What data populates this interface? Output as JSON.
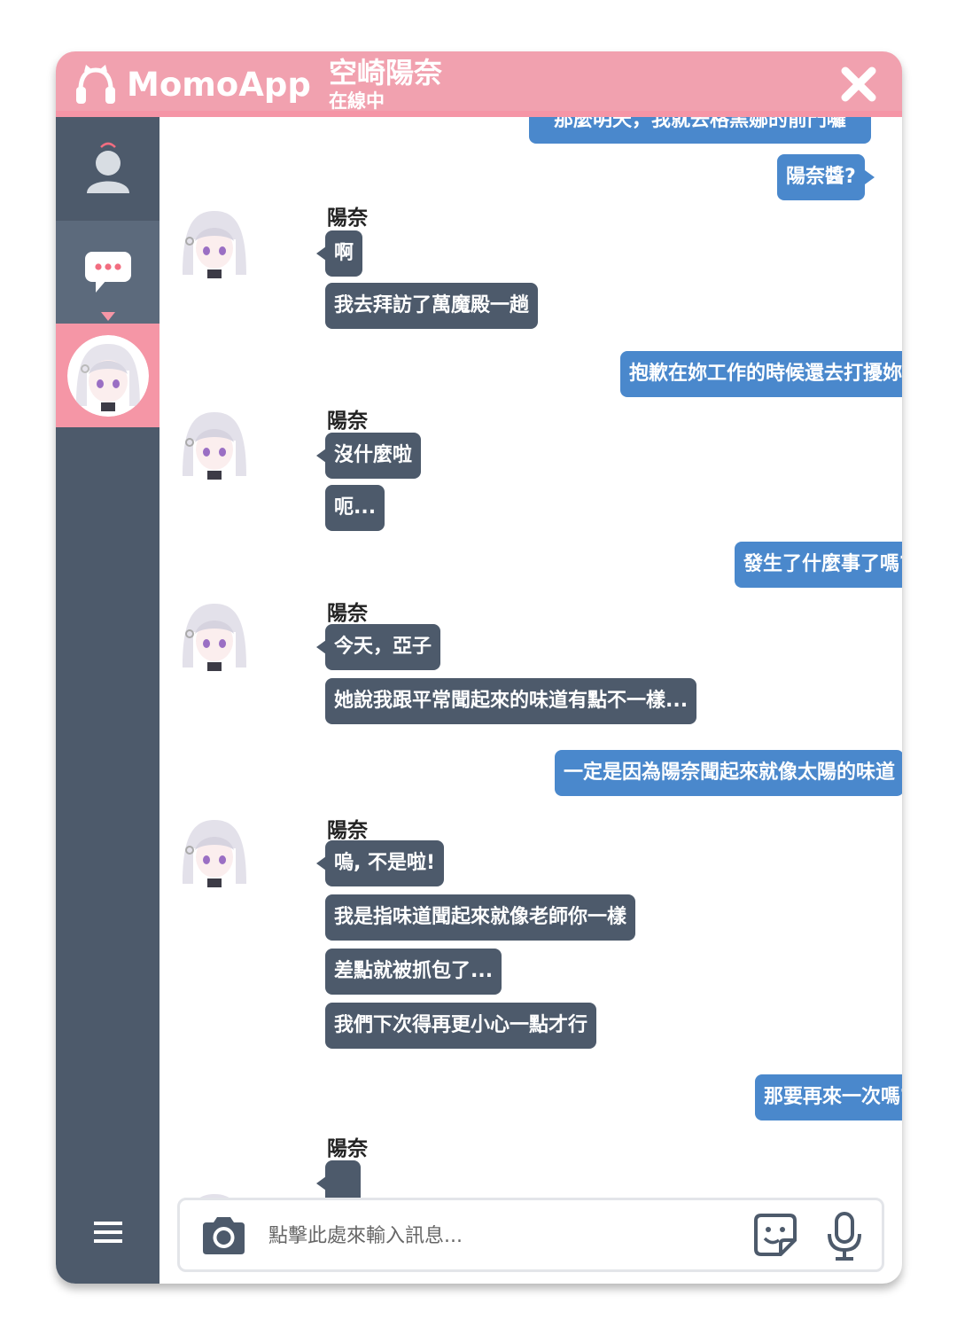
{
  "app": {
    "name": "MomoApp"
  },
  "contact": {
    "name": "空崎陽奈",
    "status": "在線中"
  },
  "colors": {
    "header": "#f1a1af",
    "sidebar": "#4d5a6b",
    "incoming_bubble": "#4d5a6b",
    "outgoing_bubble": "#4a88cc",
    "active_item": "#f596a6"
  },
  "icons": {
    "logo": "cat-headphones-icon",
    "close": "close-icon",
    "profile": "user-icon",
    "chat": "speech-bubble-icon",
    "menu": "hamburger-menu-icon",
    "camera": "camera-icon",
    "sticker": "sticker-icon",
    "mic": "microphone-icon"
  },
  "messages": [
    {
      "from": "me",
      "text": "那麼明天，我就去格黑娜的前門囉"
    },
    {
      "from": "me",
      "text": "陽奈醬?"
    },
    {
      "from": "contact",
      "sender": "陽奈",
      "texts": [
        "啊",
        "我去拜訪了萬魔殿一趟"
      ]
    },
    {
      "from": "me",
      "text": "抱歉在妳工作的時候還去打擾妳"
    },
    {
      "from": "contact",
      "sender": "陽奈",
      "texts": [
        "沒什麼啦",
        "呃..."
      ]
    },
    {
      "from": "me",
      "text": "發生了什麼事了嗎?"
    },
    {
      "from": "contact",
      "sender": "陽奈",
      "texts": [
        "今天，亞子",
        "她說我跟平常聞起來的味道有點不一樣..."
      ]
    },
    {
      "from": "me",
      "text": "一定是因為陽奈聞起來就像太陽的味道"
    },
    {
      "from": "contact",
      "sender": "陽奈",
      "texts": [
        "嗚, 不是啦!",
        "我是指味道聞起來就像老師你一樣",
        "差點就被抓包了...",
        "我們下次得再更小心一點才行"
      ]
    },
    {
      "from": "me",
      "text": "那要再來一次嗎?"
    },
    {
      "from": "contact",
      "sender": "陽奈",
      "texts": [
        ""
      ]
    }
  ],
  "input": {
    "placeholder": "點擊此處來輸入訊息..."
  }
}
